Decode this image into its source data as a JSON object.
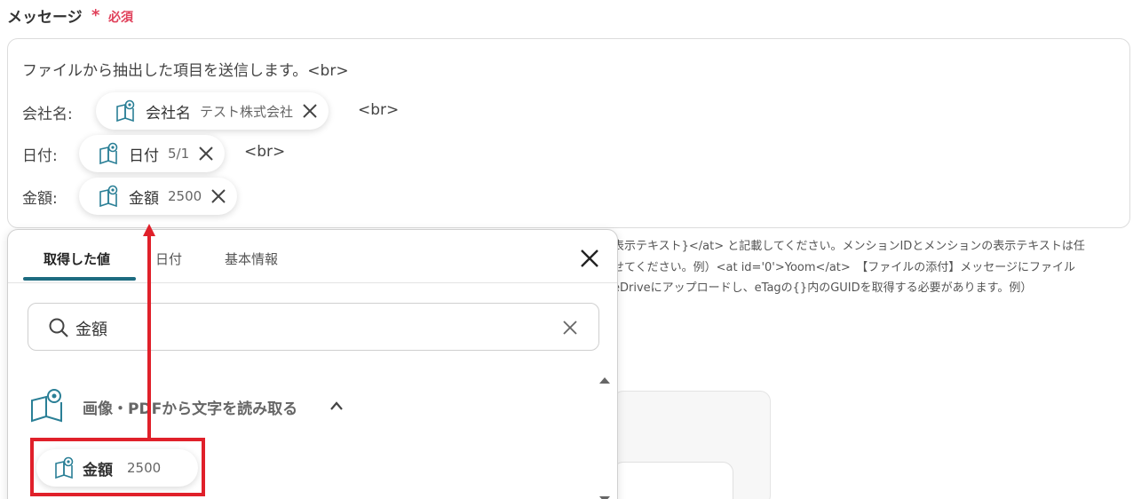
{
  "field": {
    "label": "メッセージ",
    "required_mark": "*",
    "required_text": "必須"
  },
  "message": {
    "line1": "ファイルから抽出した項目を送信します。<br>",
    "line2_label": "会社名:",
    "line3_label": "日付:",
    "line4_label": "金額:",
    "br": "<br>",
    "chips": [
      {
        "name": "会社名",
        "value": "テスト株式会社"
      },
      {
        "name": "日付",
        "value": "5/1"
      },
      {
        "name": "金額",
        "value": "2500"
      }
    ]
  },
  "help": {
    "line1": "表示テキスト}</at> と記載してください。メンションIDとメンションの表示テキストは任",
    "line2": "せてください。例）<at id='0'>Yoom</at>　【ファイルの添付】メッセージにファイル",
    "line3": "eDriveにアップロードし、eTagの{}内のGUIDを取得する必要があります。例）"
  },
  "panel": {
    "tabs": [
      "取得した値",
      "日付",
      "基本情報"
    ],
    "search_value": "金額",
    "group_title": "画像・PDFから文字を読み取る",
    "result": {
      "name": "金額",
      "value": "2500"
    }
  },
  "colors": {
    "accent": "#1d6b80",
    "required": "#e0405a",
    "highlight": "#e0202a",
    "icon": "#2a7f96"
  }
}
